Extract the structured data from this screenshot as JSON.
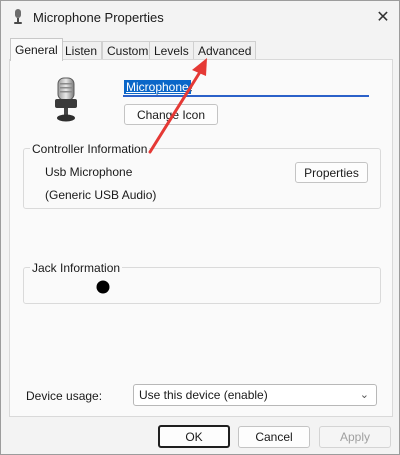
{
  "window": {
    "title": "Microphone Properties",
    "close_glyph": "✕"
  },
  "tabs": [
    {
      "label": "General",
      "active": true
    },
    {
      "label": "Listen"
    },
    {
      "label": "Custom"
    },
    {
      "label": "Levels"
    },
    {
      "label": "Advanced"
    }
  ],
  "device": {
    "icon": "microphone-icon",
    "name_value": "Microphone",
    "change_icon_label": "Change Icon"
  },
  "controller": {
    "group_label": "Controller Information",
    "name": "Usb Microphone",
    "driver": "(Generic USB Audio)",
    "properties_label": "Properties"
  },
  "jack": {
    "group_label": "Jack Information",
    "indicator_color": "#000000"
  },
  "usage": {
    "label": "Device usage:",
    "selected": "Use this device (enable)"
  },
  "footer": {
    "ok_label": "OK",
    "cancel_label": "Cancel",
    "apply_label": "Apply"
  },
  "annotation": {
    "arrow_color": "#e53935",
    "arrow_target": "tab-advanced"
  },
  "colors": {
    "accent": "#0a66c8"
  }
}
